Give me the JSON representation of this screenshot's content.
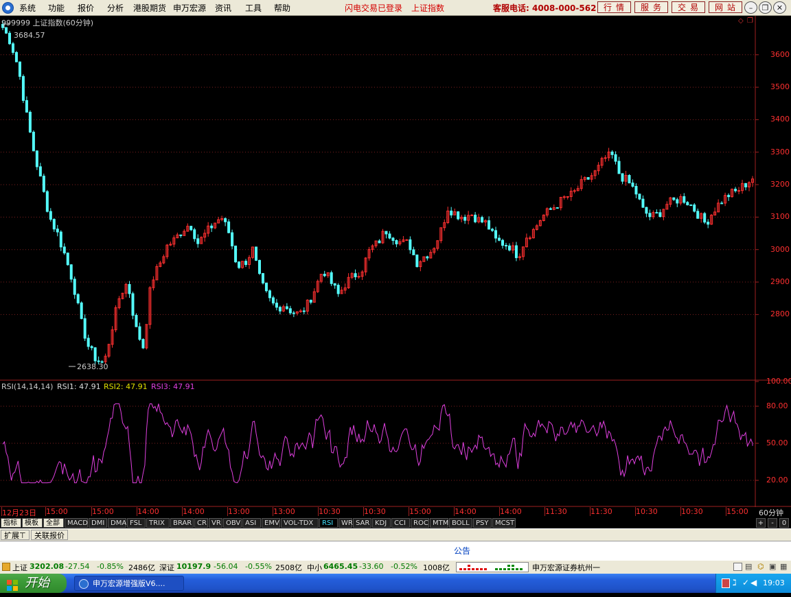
{
  "menubar": {
    "items": [
      "系统",
      "功能",
      "报价",
      "分析",
      "港股期货",
      "申万宏源",
      "资讯",
      "工具",
      "帮助"
    ],
    "login_status": "闪电交易已登录",
    "current_index": "上证指数",
    "hotline": "客服电话: 4008-000-562",
    "tabs": [
      "行情",
      "服务",
      "交易",
      "网站"
    ]
  },
  "chart": {
    "title": "999999 上证指数(60分钟)",
    "high_label": "3684.57",
    "low_label": "2638.30",
    "price_axis": [
      "3600",
      "3500",
      "3400",
      "3300",
      "3200",
      "3100",
      "3000",
      "2900",
      "2800"
    ],
    "rsi_title": "RSI(14,14,14)",
    "rsi1_label": "RSI1: 47.91",
    "rsi2_label": "RSI2: 47.91",
    "rsi3_label": "RSI3: 47.91",
    "rsi_axis": [
      "100.00",
      "80.00",
      "50.00",
      "20.00"
    ],
    "period_label": "60分钟",
    "time_axis": [
      "12月23日",
      "15:00",
      "15:00",
      "14:00",
      "14:00",
      "13:00",
      "13:00",
      "10:30",
      "10:30",
      "15:00",
      "14:00",
      "14:00",
      "11:30",
      "11:30",
      "10:30",
      "10:30",
      "15:00"
    ]
  },
  "indicator_tabs": [
    "指标",
    "模板",
    "全部",
    "MACD",
    "DMI",
    "DMA",
    "FSL",
    "TRIX",
    "BRAR",
    "CR",
    "VR",
    "OBV",
    "ASI",
    "EMV",
    "VOL-TDX",
    "RSI",
    "WR",
    "SAR",
    "KDJ",
    "CCI",
    "ROC",
    "MTM",
    "BOLL",
    "PSY",
    "MCST"
  ],
  "active_indicator": "RSI",
  "ext_tabs": [
    "扩展⊤",
    "关联报价"
  ],
  "notice": "公告",
  "status": {
    "sh_name": "上证",
    "sh_value": "3202.08",
    "sh_change": "-27.54",
    "sh_pct": "-0.85%",
    "sh_amount": "2486亿",
    "sz_name": "深证",
    "sz_value": "10197.9",
    "sz_change": "-56.04",
    "sz_pct": "-0.55%",
    "sz_amount": "2508亿",
    "zx_name": "中小",
    "zx_value": "6465.45",
    "zx_change": "-33.60",
    "zx_pct": "-0.52%",
    "zx_amount": "1008亿",
    "broker": "申万宏源证券杭州一"
  },
  "taskbar": {
    "start_label": "开始",
    "task_title": "申万宏源增强版V6....",
    "clock": "19:03"
  },
  "colors": {
    "rise_candle": "#ff3030",
    "fall_candle": "#54ffff",
    "rsi_line": "#e040e0",
    "grid": "#802020",
    "axis_text": "#ff3030"
  },
  "chart_data": {
    "type": "candlestick",
    "title": "999999 上证指数(60分钟)",
    "ylim": [
      2600,
      3720
    ],
    "high": 3684.57,
    "low": 2638.3,
    "close_path": [
      3684,
      3640,
      3560,
      3420,
      3300,
      3200,
      3100,
      3050,
      2980,
      2900,
      2780,
      2700,
      2660,
      2650,
      2760,
      2860,
      2900,
      2760,
      2700,
      2900,
      2950,
      3010,
      3030,
      3060,
      3080,
      3020,
      3050,
      3080,
      3100,
      3050,
      2950,
      2960,
      3000,
      2900,
      2850,
      2820,
      2830,
      2810,
      2800,
      2830,
      2880,
      2940,
      2900,
      2860,
      2900,
      2920,
      2940,
      3000,
      3020,
      3060,
      3040,
      3020,
      3020,
      2960,
      2980,
      3000,
      3050,
      3130,
      3110,
      3100,
      3110,
      3090,
      3080,
      3030,
      3020,
      3010,
      2980,
      3040,
      3060,
      3100,
      3120,
      3140,
      3160,
      3170,
      3200,
      3220,
      3240,
      3280,
      3290,
      3230,
      3210,
      3180,
      3120,
      3100,
      3110,
      3140,
      3150,
      3160,
      3140,
      3110,
      3080,
      3120,
      3150,
      3170,
      3180,
      3200,
      3220
    ],
    "rsi_ylim": [
      0,
      100
    ],
    "rsi_last": 47.91
  }
}
